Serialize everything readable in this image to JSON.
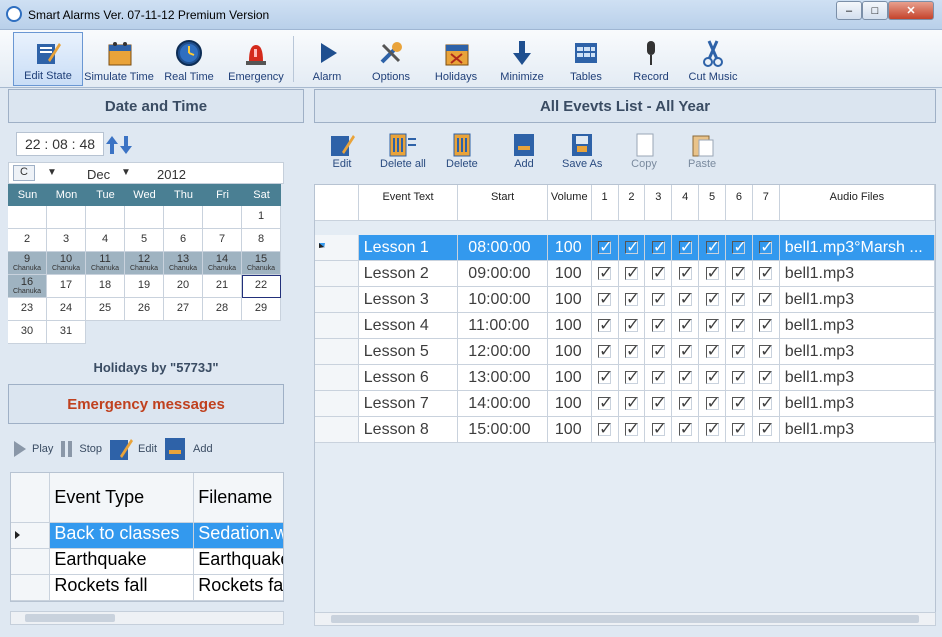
{
  "window": {
    "title": "Smart Alarms Ver. 07-11-12 Premium Version",
    "controls": {
      "minimize": "–",
      "maximize": "□",
      "close": "✕"
    }
  },
  "toolbar": {
    "items": [
      {
        "label": "Edit State",
        "icon": "edit-state-icon"
      },
      {
        "label": "Simulate Time",
        "icon": "calendar-icon"
      },
      {
        "label": "Real Time",
        "icon": "clock-icon"
      },
      {
        "label": "Emergency",
        "icon": "siren-icon"
      },
      {
        "label": "Alarm",
        "icon": "play-icon"
      },
      {
        "label": "Options",
        "icon": "tools-icon"
      },
      {
        "label": "Holidays",
        "icon": "holidays-calendar-icon"
      },
      {
        "label": "Minimize",
        "icon": "down-arrow-icon"
      },
      {
        "label": "Tables",
        "icon": "table-icon"
      },
      {
        "label": "Record",
        "icon": "microphone-icon"
      },
      {
        "label": "Cut Music",
        "icon": "scissors-icon"
      }
    ]
  },
  "date_panel": {
    "title": "Date and Time",
    "time": "22 : 08 : 48",
    "calendar": {
      "c_button": "C",
      "month": "Dec",
      "year": "2012",
      "day_headers": [
        "Sun",
        "Mon",
        "Tue",
        "Wed",
        "Thu",
        "Fri",
        "Sat"
      ],
      "holiday_note": "Chanuka"
    },
    "holidays_label": "Holidays by \"5773J\""
  },
  "emergency": {
    "title": "Emergency messages",
    "tools": {
      "play": "Play",
      "stop": "Stop",
      "edit": "Edit",
      "add": "Add"
    },
    "columns": [
      "Event Type",
      "Filename"
    ],
    "rows": [
      {
        "type": "Back to classes",
        "file": "Sedation.w"
      },
      {
        "type": "Earthquake",
        "file": "Earthquake"
      },
      {
        "type": "Rockets fall",
        "file": "Rockets fa"
      }
    ]
  },
  "events": {
    "title": "All Evevts List - All Year",
    "tools": {
      "edit": "Edit",
      "delete_all": "Delete all",
      "delete": "Delete",
      "add": "Add",
      "save_as": "Save As",
      "copy": "Copy",
      "paste": "Paste"
    },
    "columns": {
      "text": "Event Text",
      "start": "Start",
      "volume": "Volume",
      "days": [
        "1",
        "2",
        "3",
        "4",
        "5",
        "6",
        "7"
      ],
      "audio": "Audio Files"
    },
    "rows": [
      {
        "text": "Lesson 1",
        "start": "08:00:00",
        "volume": "100",
        "audio": "bell1.mp3°Marsh ..."
      },
      {
        "text": "Lesson 2",
        "start": "09:00:00",
        "volume": "100",
        "audio": "bell1.mp3"
      },
      {
        "text": "Lesson 3",
        "start": "10:00:00",
        "volume": "100",
        "audio": "bell1.mp3"
      },
      {
        "text": "Lesson 4",
        "start": "11:00:00",
        "volume": "100",
        "audio": "bell1.mp3"
      },
      {
        "text": "Lesson 5",
        "start": "12:00:00",
        "volume": "100",
        "audio": "bell1.mp3"
      },
      {
        "text": "Lesson 6",
        "start": "13:00:00",
        "volume": "100",
        "audio": "bell1.mp3"
      },
      {
        "text": "Lesson 7",
        "start": "14:00:00",
        "volume": "100",
        "audio": "bell1.mp3"
      },
      {
        "text": "Lesson 8",
        "start": "15:00:00",
        "volume": "100",
        "audio": "bell1.mp3"
      }
    ]
  }
}
